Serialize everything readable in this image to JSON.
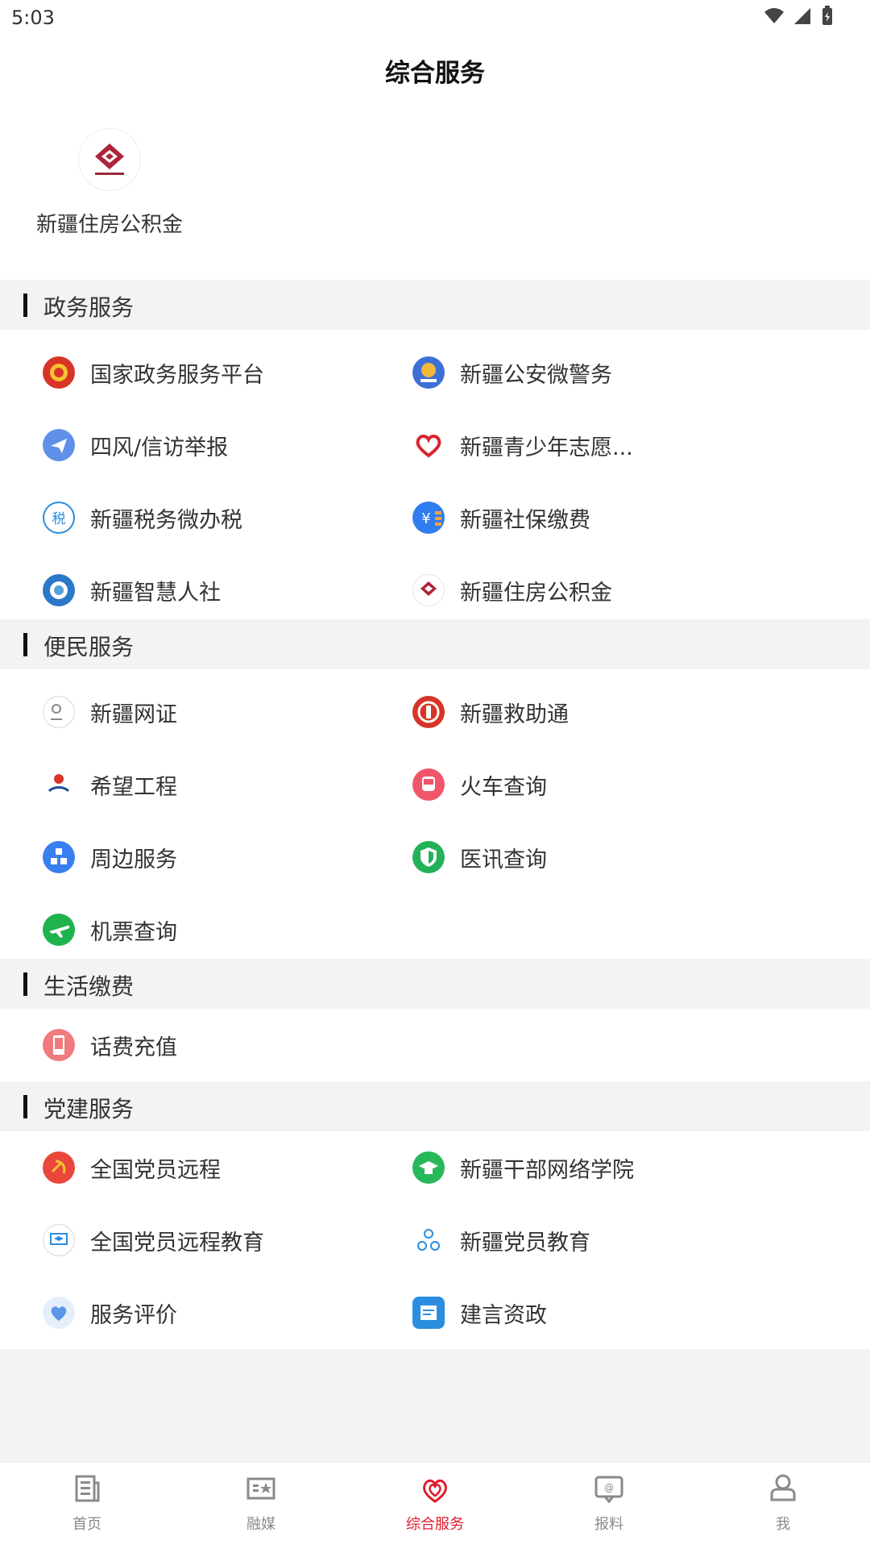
{
  "status": {
    "time": "5:03"
  },
  "header": {
    "title": "综合服务"
  },
  "featured": {
    "label": "新疆住房公积金"
  },
  "sections": [
    {
      "title": "政务服务",
      "items": [
        {
          "label": "国家政务服务平台"
        },
        {
          "label": "新疆公安微警务"
        },
        {
          "label": "四风/信访举报"
        },
        {
          "label": "新疆青少年志愿..."
        },
        {
          "label": "新疆税务微办税"
        },
        {
          "label": "新疆社保缴费"
        },
        {
          "label": "新疆智慧人社"
        },
        {
          "label": "新疆住房公积金"
        }
      ]
    },
    {
      "title": "便民服务",
      "items": [
        {
          "label": "新疆网证"
        },
        {
          "label": "新疆救助通"
        },
        {
          "label": "希望工程"
        },
        {
          "label": "火车查询"
        },
        {
          "label": "周边服务"
        },
        {
          "label": "医讯查询"
        },
        {
          "label": "机票查询"
        }
      ]
    },
    {
      "title": "生活缴费",
      "items": [
        {
          "label": "话费充值"
        }
      ]
    },
    {
      "title": "党建服务",
      "items": [
        {
          "label": "全国党员远程"
        },
        {
          "label": "新疆干部网络学院"
        },
        {
          "label": "全国党员远程教育"
        },
        {
          "label": "新疆党员教育"
        },
        {
          "label": "服务评价"
        },
        {
          "label": "建言资政"
        }
      ]
    }
  ],
  "nav": {
    "items": [
      {
        "label": "首页"
      },
      {
        "label": "融媒"
      },
      {
        "label": "综合服务"
      },
      {
        "label": "报料"
      },
      {
        "label": "我"
      }
    ]
  }
}
